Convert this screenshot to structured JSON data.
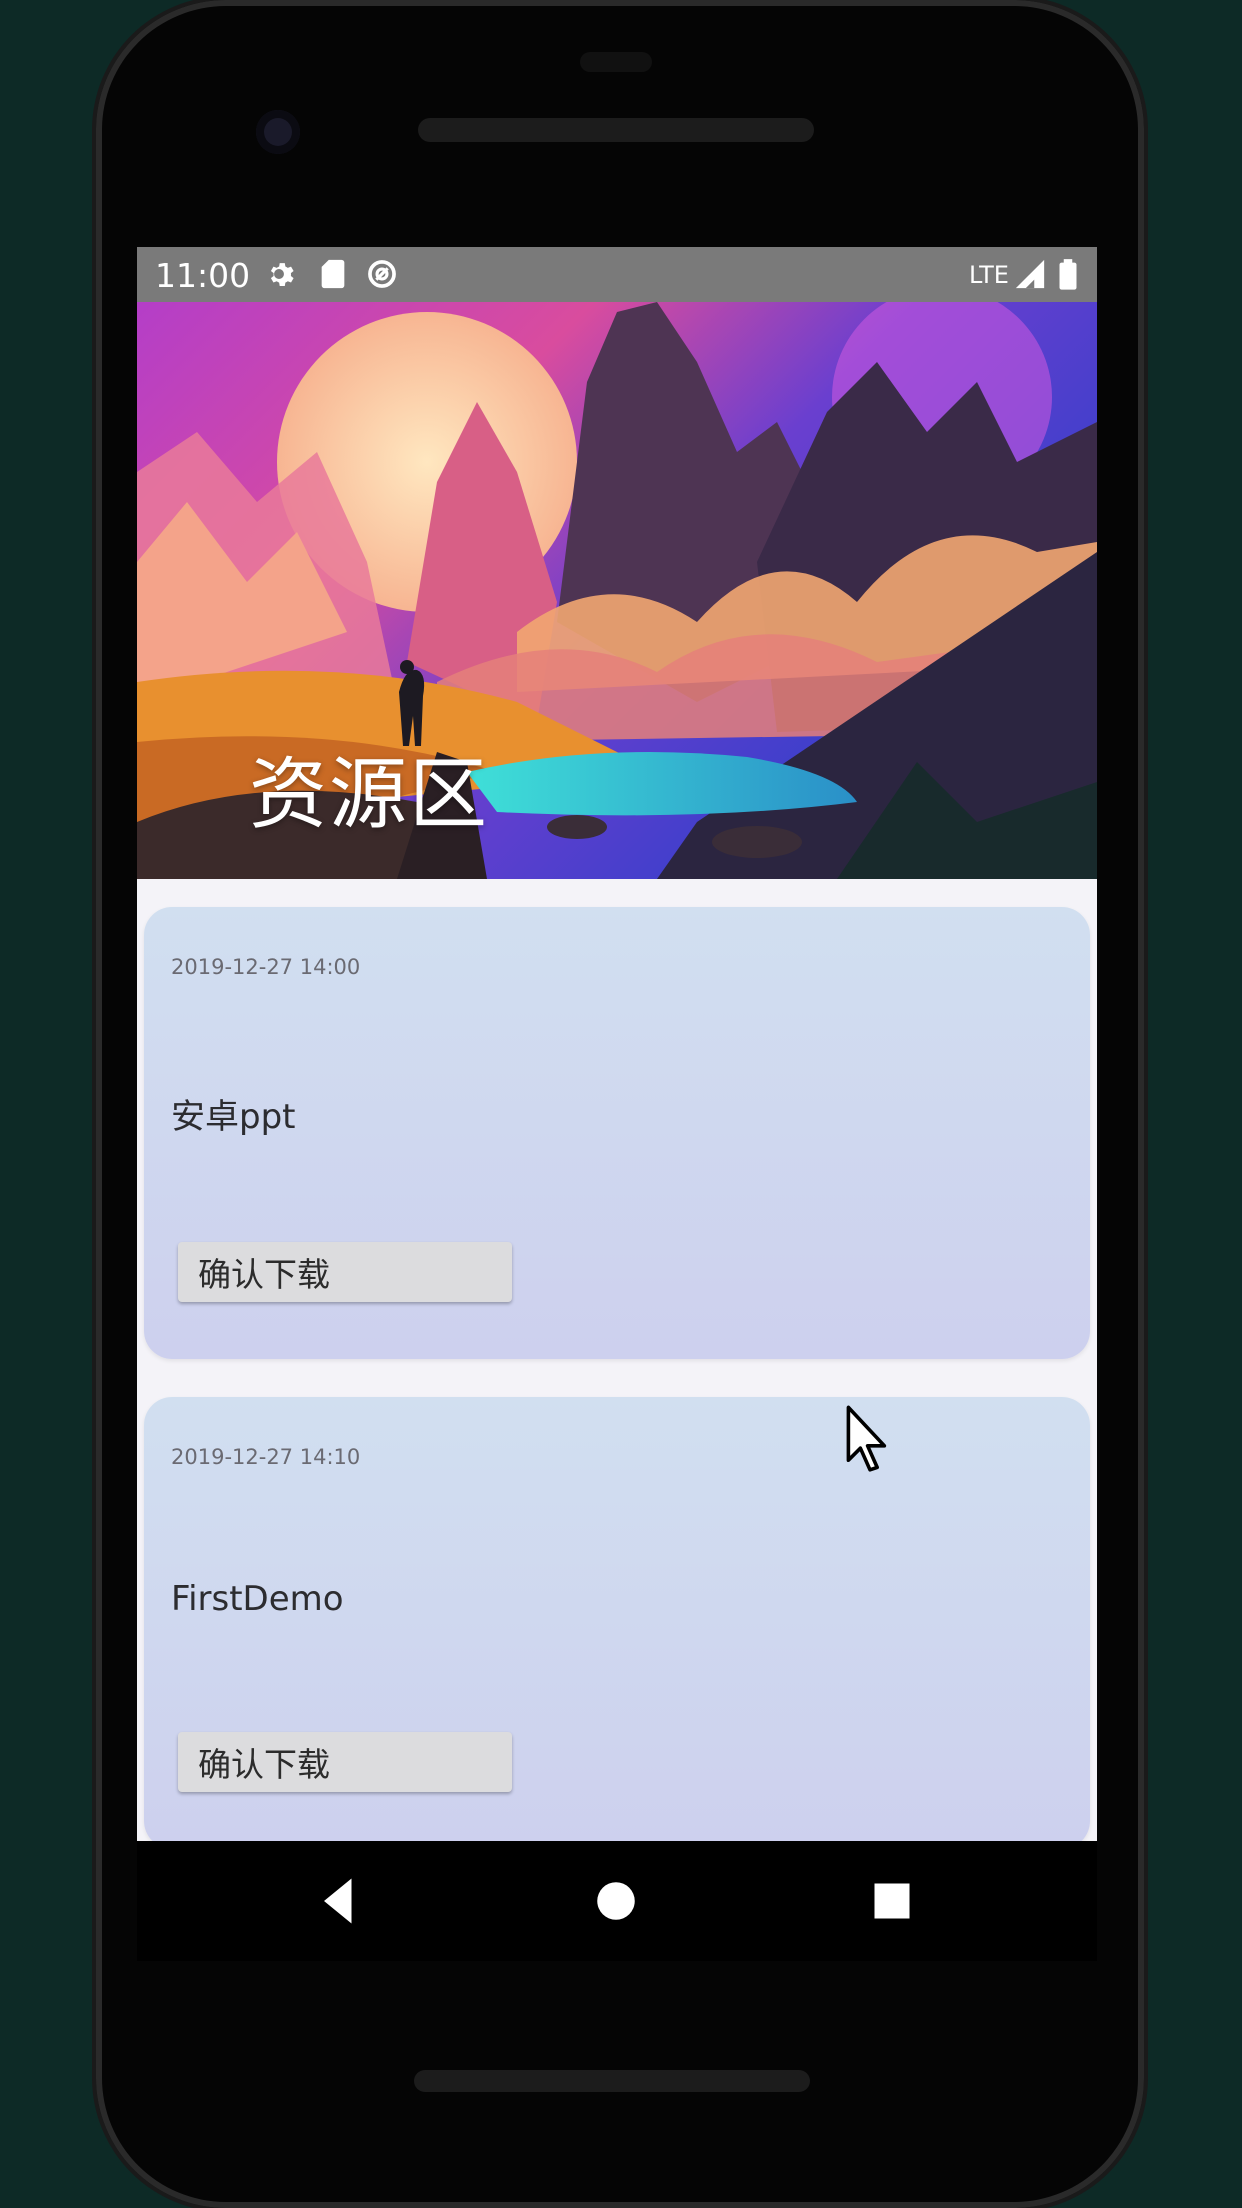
{
  "status_bar": {
    "time": "11:00",
    "network": "LTE",
    "left_icons": [
      "gear-icon",
      "sd-card-icon",
      "data-saver-icon"
    ],
    "right_icons": [
      "signal-icon",
      "battery-icon"
    ]
  },
  "header": {
    "title": "资源区"
  },
  "resources": [
    {
      "date": "2019-12-27 14:00",
      "title": "安卓ppt",
      "button_label": "确认下载"
    },
    {
      "date": "2019-12-27 14:10",
      "title": "FirstDemo",
      "button_label": "确认下载"
    }
  ],
  "nav_bar": {
    "buttons": [
      "back-icon",
      "home-icon",
      "recents-icon"
    ]
  },
  "colors": {
    "card_top": "#d1dff0",
    "card_bottom": "#cdd0ee",
    "status_bar": "#7a7a7a",
    "screen_bg": "#f4f3f8"
  }
}
